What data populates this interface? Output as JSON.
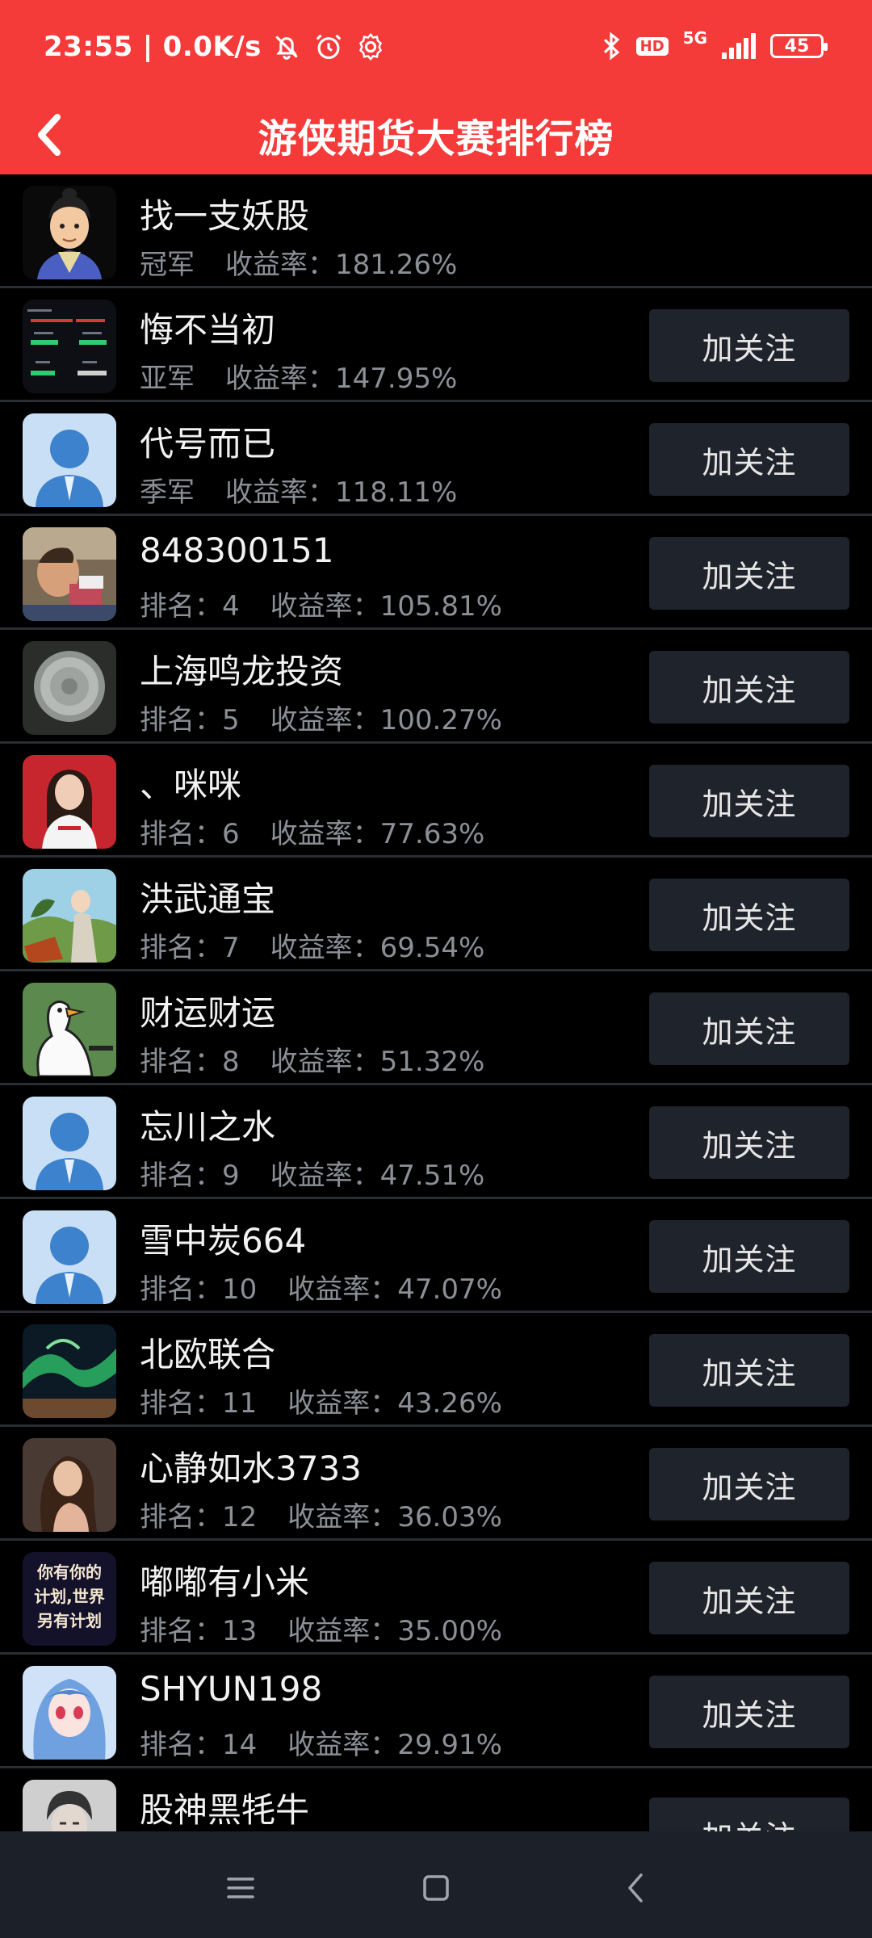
{
  "status": {
    "time": "23:55",
    "speed": "0.0K/s",
    "network": "5G",
    "hd": "HD",
    "battery": "45"
  },
  "header": {
    "title": "游侠期货大赛排行榜"
  },
  "colors": {
    "accent": "#f53a3a",
    "background": "#000000",
    "button_bg": "#1f232b",
    "subtext": "#8b8f96",
    "navbar": "#1c2029"
  },
  "follow_label": "加关注",
  "yield_label": "收益率：",
  "rows": [
    {
      "name": "找一支妖股",
      "rank": "冠军",
      "yield": "181.26%",
      "avatar": "cartoon-man-avatar",
      "follow": false
    },
    {
      "name": "悔不当初",
      "rank": "亚军",
      "yield": "147.95%",
      "avatar": "stock-screenshot-avatar",
      "follow": true
    },
    {
      "name": "代号而已",
      "rank": "季军",
      "yield": "118.11%",
      "avatar": "default-user-avatar",
      "follow": true
    },
    {
      "name": "848300151",
      "rank": "排名：4",
      "yield": "105.81%",
      "avatar": "photo-avatar",
      "follow": true
    },
    {
      "name": "上海鸣龙投资",
      "rank": "排名：5",
      "yield": "100.27%",
      "avatar": "photo-avatar",
      "follow": true
    },
    {
      "name": "、咪咪",
      "rank": "排名：6",
      "yield": "77.63%",
      "avatar": "photo-avatar",
      "follow": true
    },
    {
      "name": "洪武通宝",
      "rank": "排名：7",
      "yield": "69.54%",
      "avatar": "photo-avatar",
      "follow": true
    },
    {
      "name": "财运财运",
      "rank": "排名：8",
      "yield": "51.32%",
      "avatar": "goose-avatar",
      "follow": true
    },
    {
      "name": "忘川之水",
      "rank": "排名：9",
      "yield": "47.51%",
      "avatar": "default-user-avatar",
      "follow": true
    },
    {
      "name": "雪中炭664",
      "rank": "排名：10",
      "yield": "47.07%",
      "avatar": "default-user-avatar",
      "follow": true
    },
    {
      "name": "北欧联合",
      "rank": "排名：11",
      "yield": "43.26%",
      "avatar": "aurora-avatar",
      "follow": true
    },
    {
      "name": "心静如水3733",
      "rank": "排名：12",
      "yield": "36.03%",
      "avatar": "photo-avatar",
      "follow": true
    },
    {
      "name": "嘟嘟有小米",
      "rank": "排名：13",
      "yield": "35.00%",
      "avatar": "text-poster-avatar",
      "follow": true
    },
    {
      "name": "SHYUN198",
      "rank": "排名：14",
      "yield": "29.91%",
      "avatar": "anime-avatar",
      "follow": true
    },
    {
      "name": "股神黑牦牛",
      "rank": "",
      "yield": "",
      "avatar": "photo-avatar",
      "follow": true
    }
  ],
  "poster_text": [
    "你有你的",
    "计划,世界",
    "另有计划"
  ]
}
